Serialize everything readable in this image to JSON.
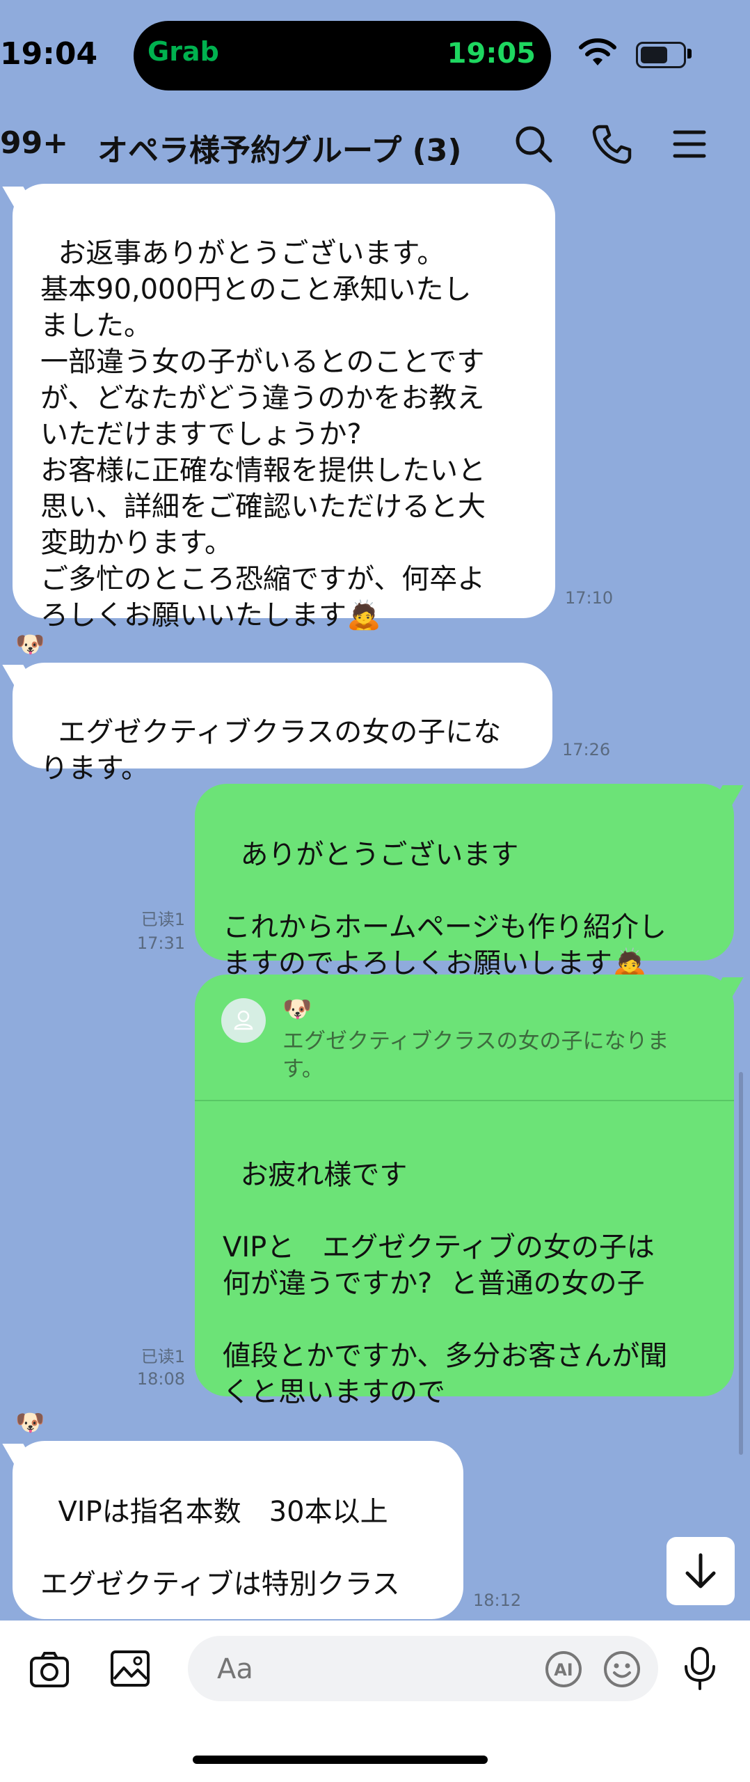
{
  "status_bar": {
    "time": "19:04",
    "island_app": "Grab",
    "island_time": "19:05"
  },
  "header": {
    "unread_count": "99+",
    "title": "オペラ様予約グループ (3)",
    "icons": [
      "search-icon",
      "phone-icon",
      "menu-icon"
    ]
  },
  "messages": [
    {
      "side": "in",
      "text": "お返事ありがとうございます。\n基本90,000円とのこと承知いたし\nました。\n一部違う女の子がいるとのことです\nが、どなたがどう違うのかをお教え\nいただけますでしょうか?\nお客様に正確な情報を提供したいと\n思い、詳細をご確認いただけると大\n変助かります。\nご多忙のところ恐縮ですが、何卒よ\nろしくお願いいたします🙇",
      "time": "17:10"
    },
    {
      "side": "in",
      "avatar": "🐶",
      "text": "エグゼクティブクラスの女の子にな\nります。",
      "time": "17:26"
    },
    {
      "side": "out",
      "read": "已读1",
      "text": "ありがとうございます\n\nこれからホームページも作り紹介し\nますのでよろしくお願いします🙇",
      "time": "17:31"
    },
    {
      "side": "out",
      "read": "已读1",
      "reply_name": "🐶",
      "reply_text": "エグゼクティブクラスの女の子になりま\nす。",
      "text": "お疲れ様です\n\nVIPと　エグゼクティブの女の子は\n何が違うですか?  と普通の女の子\n\n値段とかですか、多分お客さんが聞\nくと思いますので",
      "time": "18:08"
    },
    {
      "side": "in",
      "avatar": "🐶",
      "text": "VIPは指名本数　30本以上\n\nエグゼクティブは特別クラス",
      "time": "18:12"
    }
  ],
  "input": {
    "placeholder": "Aa"
  },
  "colors": {
    "background": "#8fabdc",
    "outgoing_bubble": "#6ce377",
    "incoming_bubble": "#ffffff"
  }
}
